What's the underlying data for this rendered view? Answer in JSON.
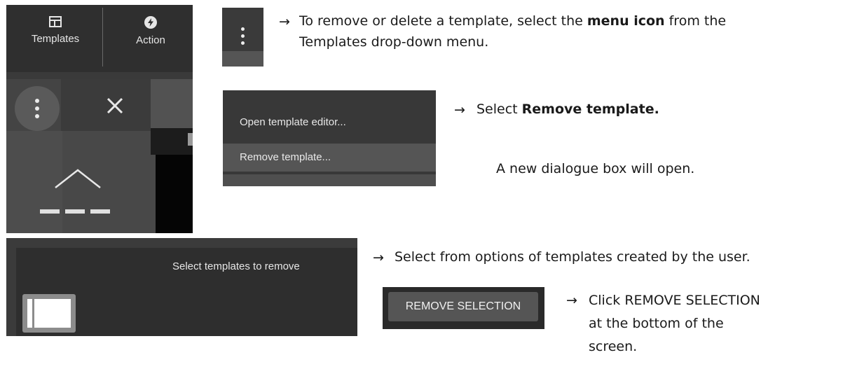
{
  "toolbar": {
    "templates_label": "Templates",
    "action_label": "Action",
    "templates_icon": "template-grid-icon",
    "action_icon": "bolt-icon"
  },
  "panel": {
    "kebab_icon": "kebab-menu-icon",
    "close_icon": "close-icon",
    "chevron_icon": "chevron-up-icon"
  },
  "context_menu": {
    "items": [
      "Open template editor...",
      "Remove template..."
    ],
    "highlighted_item": "Remove template..."
  },
  "dialog": {
    "title": "Select templates to remove"
  },
  "remove_button": {
    "label": "REMOVE SELECTION"
  },
  "instructions": {
    "arrow": "→",
    "step1": {
      "before": "To remove or delete a template, select the ",
      "bold": "menu icon",
      "after": " from the",
      "line2": "Templates drop-down menu."
    },
    "step2": {
      "before": "Select ",
      "bold": "Remove template."
    },
    "step2_note": "A new dialogue box will open.",
    "step3": "Select from options of templates created by the user.",
    "step4": {
      "line1": "Click REMOVE SELECTION",
      "line2": "at the bottom of the",
      "line3": "screen."
    }
  },
  "colors": {
    "ui_dark": "#2f2f2f",
    "ui_mid": "#444444",
    "menu_highlight": "#555555",
    "text_light": "#e8e8e8"
  }
}
